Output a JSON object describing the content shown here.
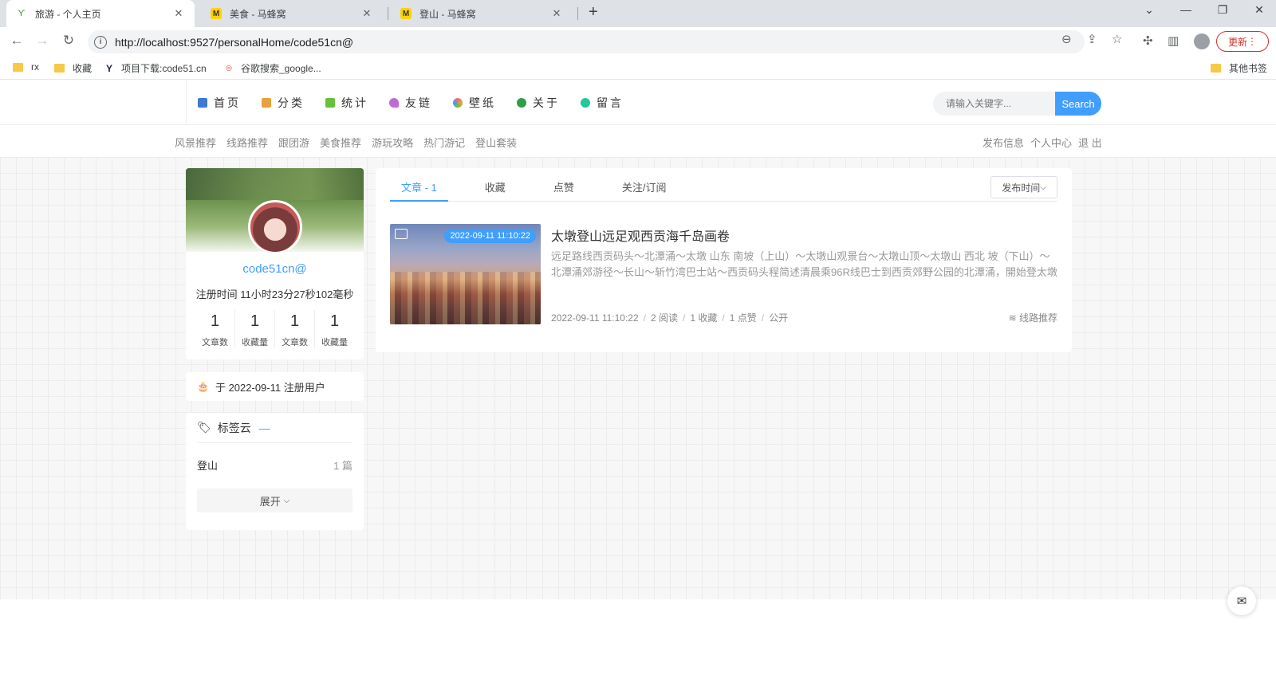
{
  "browser": {
    "tabs": [
      {
        "title": "旅游 - 个人主页",
        "icon": "sprout-icon"
      },
      {
        "title": "美食 - 马蜂窝",
        "icon": "mafengwo-icon"
      },
      {
        "title": "登山 - 马蜂窝",
        "icon": "mafengwo-icon"
      }
    ],
    "url": "http://localhost:9527/personalHome/code51cn@",
    "update_label": "更新",
    "bookmarks": [
      {
        "label": "rx",
        "icon": "folder-icon"
      },
      {
        "label": "收藏",
        "icon": "folder-icon"
      },
      {
        "label": "项目下载:code51.cn",
        "icon": "y-icon"
      },
      {
        "label": "谷歌搜索_google...",
        "icon": "360-icon"
      }
    ],
    "other_bookmarks": "其他书签"
  },
  "site": {
    "nav": [
      {
        "label": "首页",
        "color": "#3b7bd4"
      },
      {
        "label": "分类",
        "color": "#e6a23c"
      },
      {
        "label": "统计",
        "color": "#67c23a"
      },
      {
        "label": "友链",
        "color": "#c06ad8"
      },
      {
        "label": "壁纸",
        "color": "#f56c6c"
      },
      {
        "label": "关于",
        "color": "#2f9e44"
      },
      {
        "label": "留言",
        "color": "#20c997"
      }
    ],
    "search_placeholder": "请输入关键字...",
    "search_button": "Search",
    "subnav": [
      "风景推荐",
      "线路推荐",
      "跟团游",
      "美食推荐",
      "游玩攻略",
      "热门游记",
      "登山套装"
    ],
    "subnav_right": [
      "发布信息",
      "个人中心",
      "退 出"
    ]
  },
  "profile": {
    "username": "code51cn@",
    "register_time": "注册时间 11小时23分27秒102毫秒",
    "stats": [
      {
        "num": "1",
        "label": "文章数"
      },
      {
        "num": "1",
        "label": "收藏量"
      },
      {
        "num": "1",
        "label": "文章数"
      },
      {
        "num": "1",
        "label": "收藏量"
      }
    ],
    "registered_text": "于 2022-09-11 注册用户"
  },
  "tag_cloud": {
    "title": "标签云",
    "dash": "—",
    "tags": [
      {
        "name": "登山",
        "count": "1 篇"
      }
    ],
    "expand_label": "展开"
  },
  "main": {
    "tabs": [
      "文章 - 1",
      "收藏",
      "点赞",
      "关注/订阅"
    ],
    "sort_label": "发布时间",
    "article": {
      "date_badge": "2022-09-11 11:10:22",
      "title": "太墩登山远足观西贡海千岛画卷",
      "desc": "远足路线西贡码头～北潭涌～太墩 山东 南坡（上山）～太墩山观景台～太墩山顶～太墩山 西北 坡（下山）～北潭涌郊游径～长山～斩竹湾巴士站～西贡码头程简述清晨乘96R线巴士到西贡郊野公园的北潭涌，開始登太墩山...",
      "meta": {
        "date": "2022-09-11 11:10:22",
        "reads": "2 阅读",
        "favs": "1 收藏",
        "likes": "1 点赞",
        "visibility": "公开"
      },
      "category": "线路推荐"
    }
  }
}
